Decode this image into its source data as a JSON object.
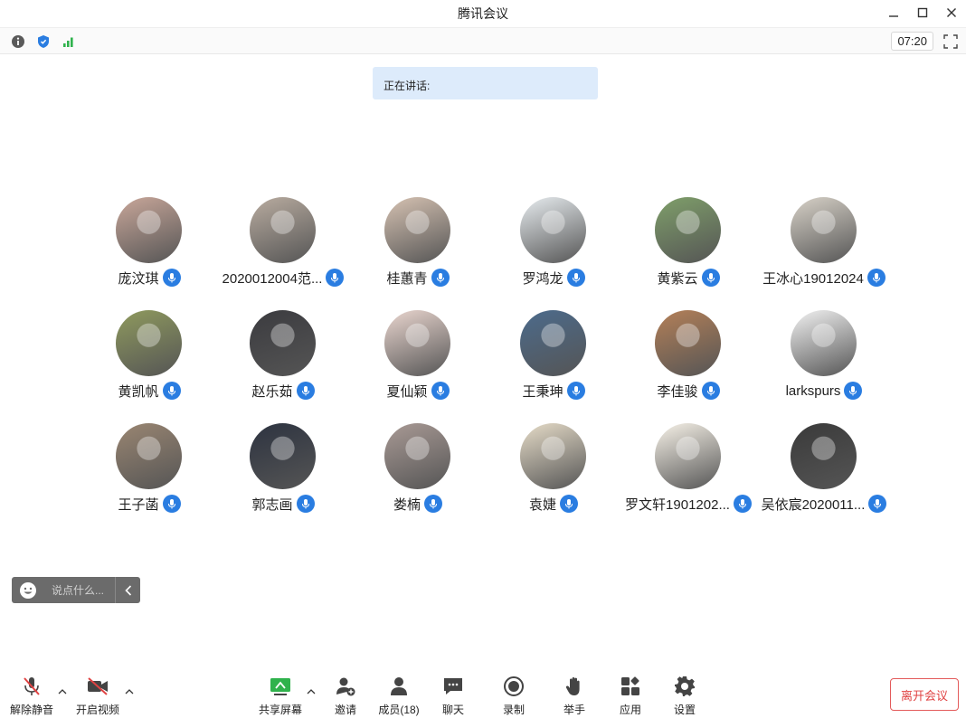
{
  "window": {
    "title": "腾讯会议"
  },
  "infobar": {
    "timer": "07:20"
  },
  "speaking": {
    "label": "正在讲话:"
  },
  "participants": [
    {
      "name": "庞汶琪",
      "avatar": "#c9a79a"
    },
    {
      "name": "2020012004范...",
      "avatar": "#b9aca0"
    },
    {
      "name": "桂蕙青",
      "avatar": "#d6c2b2"
    },
    {
      "name": "罗鸿龙",
      "avatar": "#e7ecef"
    },
    {
      "name": "黄紫云",
      "avatar": "#7f9f6a"
    },
    {
      "name": "王冰心19012024",
      "avatar": "#d8d2c8"
    },
    {
      "name": "黄凯帆",
      "avatar": "#8f9a5e"
    },
    {
      "name": "赵乐茹",
      "avatar": "#3b3b3f"
    },
    {
      "name": "夏仙颖",
      "avatar": "#ead6cf"
    },
    {
      "name": "王秉珅",
      "avatar": "#4c6b8c"
    },
    {
      "name": "李佳骏",
      "avatar": "#b48058"
    },
    {
      "name": "larkspurs",
      "avatar": "#f2f2f2"
    },
    {
      "name": "王子菡",
      "avatar": "#9a8672"
    },
    {
      "name": "郭志画",
      "avatar": "#2d3340"
    },
    {
      "name": "娄楠",
      "avatar": "#a99a95"
    },
    {
      "name": "袁婕",
      "avatar": "#e6dcc8"
    },
    {
      "name": "罗文轩1901202...",
      "avatar": "#f7f2e8"
    },
    {
      "name": "吴依宸2020011...",
      "avatar": "#3a3a3a"
    }
  ],
  "chat": {
    "placeholder": "说点什么..."
  },
  "toolbar": {
    "unmute": "解除静音",
    "video": "开启视频",
    "share": "共享屏幕",
    "invite": "邀请",
    "members": "成员(18)",
    "chat": "聊天",
    "record": "录制",
    "raise_hand": "举手",
    "apps": "应用",
    "settings": "设置",
    "leave": "离开会议"
  },
  "colors": {
    "accent": "#2a7de1",
    "leave": "#e04343",
    "banner": "#ddebfb"
  }
}
